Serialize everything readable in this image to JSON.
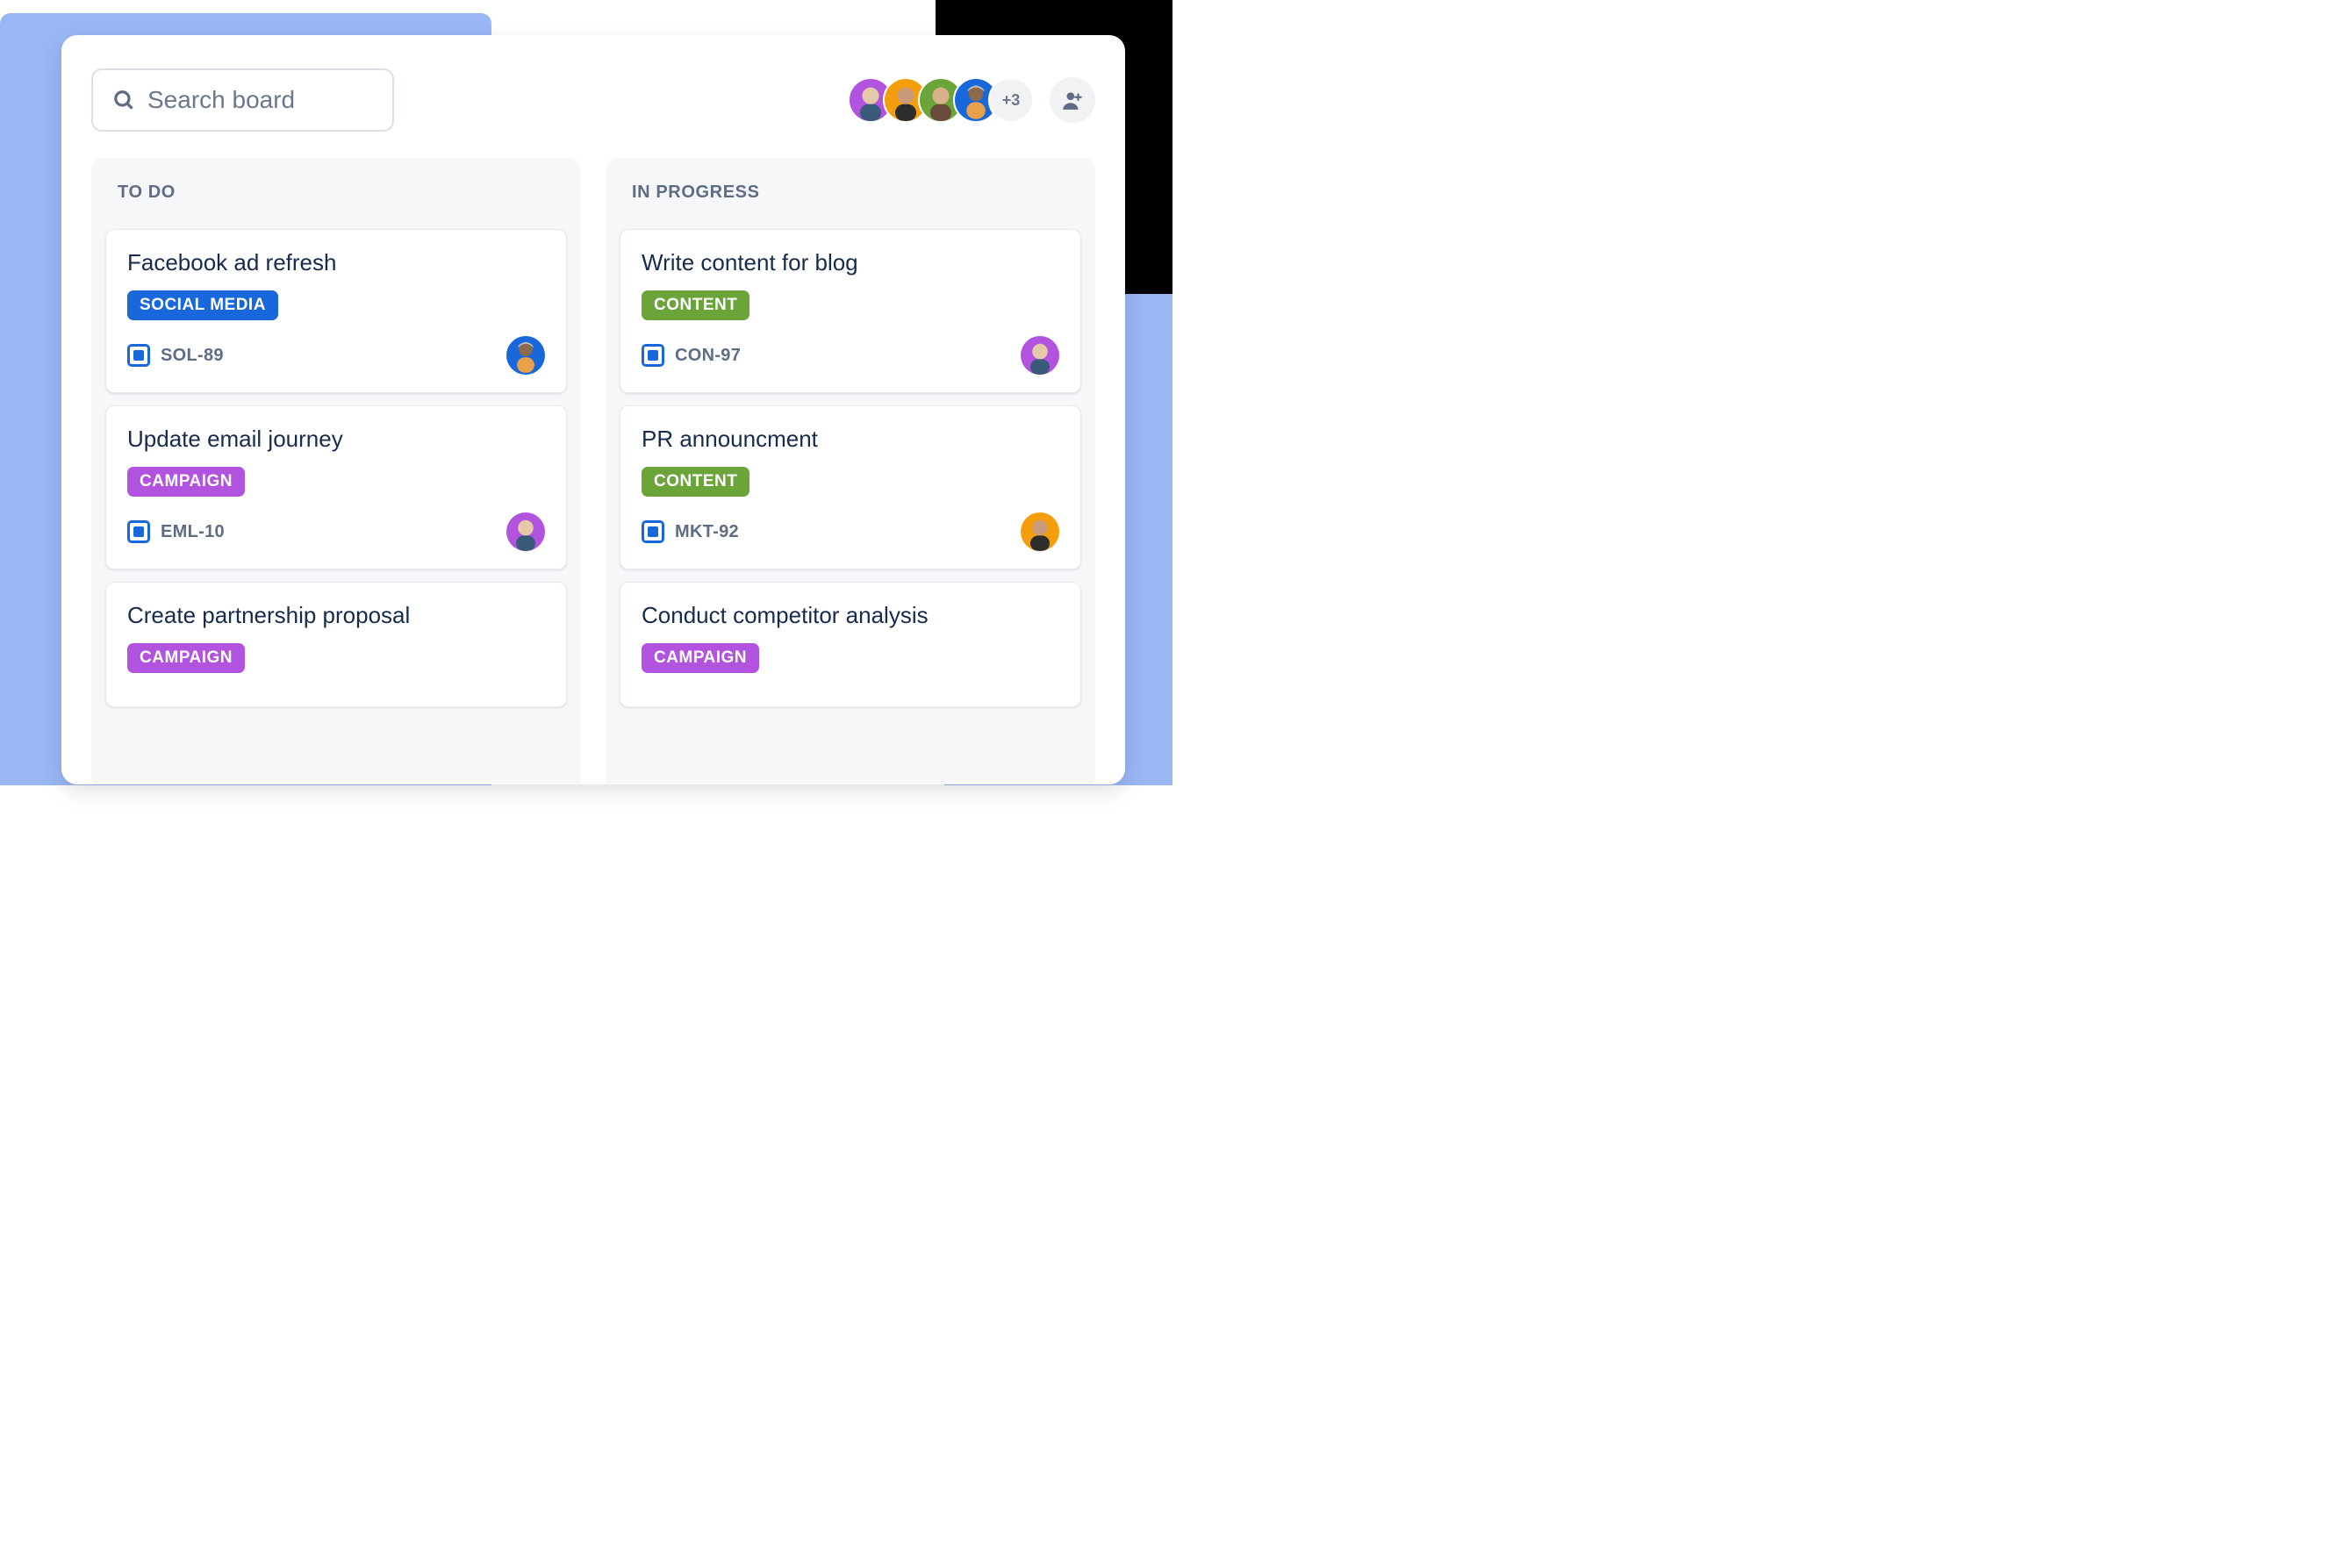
{
  "search": {
    "placeholder": "Search board"
  },
  "avatars": {
    "colors": [
      "#b253e0",
      "#f59e0b",
      "#6ba53a",
      "#1868db"
    ],
    "more_label": "+3"
  },
  "tag_colors": {
    "SOCIAL MEDIA": "#1868db",
    "CAMPAIGN": "#b253e0",
    "CONTENT": "#6ba53a"
  },
  "assignee_colors": {
    "blue": "#1868db",
    "purple": "#b253e0",
    "orange": "#f59e0b"
  },
  "columns": [
    {
      "title": "TO DO",
      "cards": [
        {
          "title": "Facebook ad refresh",
          "tag": "SOCIAL MEDIA",
          "key": "SOL-89",
          "assignee": "blue"
        },
        {
          "title": "Update email journey",
          "tag": "CAMPAIGN",
          "key": "EML-10",
          "assignee": "purple"
        },
        {
          "title": "Create partnership proposal",
          "tag": "CAMPAIGN",
          "key": "",
          "assignee": ""
        }
      ]
    },
    {
      "title": "IN PROGRESS",
      "cards": [
        {
          "title": "Write content for blog",
          "tag": "CONTENT",
          "key": "CON-97",
          "assignee": "purple"
        },
        {
          "title": "PR announcment",
          "tag": "CONTENT",
          "key": "MKT-92",
          "assignee": "orange"
        },
        {
          "title": "Conduct competitor analysis",
          "tag": "CAMPAIGN",
          "key": "",
          "assignee": ""
        }
      ]
    }
  ]
}
